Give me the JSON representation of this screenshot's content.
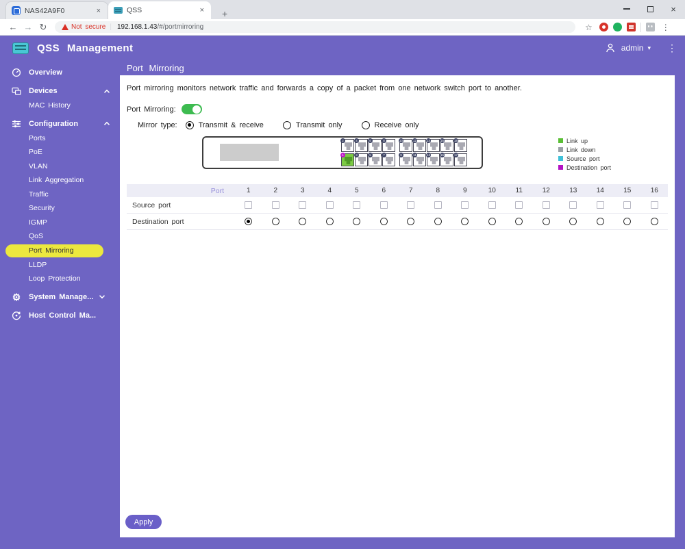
{
  "icons": {
    "back": "←",
    "forward": "→",
    "reload": "↻",
    "star": "☆",
    "menu_dots": "⋮",
    "close_x": "×",
    "new_tab": "+",
    "caret_down": "▾",
    "gear": "⚙"
  },
  "browser": {
    "tabs": [
      {
        "title": "NAS42A9F0",
        "active": false
      },
      {
        "title": "QSS",
        "active": true
      }
    ],
    "security_warning": "Not secure",
    "url_host": "192.168.1.43",
    "url_path": "/#/portmirroring",
    "url_separator": "|"
  },
  "header": {
    "app_title": "QSS Management",
    "user": "admin"
  },
  "sidebar": {
    "items": [
      {
        "label": "Overview",
        "icon": "gauge",
        "type": "top"
      },
      {
        "label": "Devices",
        "icon": "devices",
        "type": "top",
        "chevron": "up"
      },
      {
        "label": "MAC History",
        "type": "sub"
      },
      {
        "label": "Configuration",
        "icon": "sliders",
        "type": "top",
        "chevron": "up"
      },
      {
        "label": "Ports",
        "type": "sub"
      },
      {
        "label": "PoE",
        "type": "sub"
      },
      {
        "label": "VLAN",
        "type": "sub"
      },
      {
        "label": "Link Aggregation",
        "type": "sub"
      },
      {
        "label": "Traffic",
        "type": "sub"
      },
      {
        "label": "Security",
        "type": "sub"
      },
      {
        "label": "IGMP",
        "type": "sub"
      },
      {
        "label": "QoS",
        "type": "sub"
      },
      {
        "label": "Port Mirroring",
        "type": "sub",
        "active": true
      },
      {
        "label": "LLDP",
        "type": "sub"
      },
      {
        "label": "Loop Protection",
        "type": "sub"
      },
      {
        "label": "System Manage...",
        "icon": "gear",
        "type": "top",
        "chevron": "down",
        "chevron_inline": true
      },
      {
        "label": "Host Control Ma...",
        "icon": "host",
        "type": "top"
      }
    ]
  },
  "page": {
    "title": "Port Mirroring",
    "description": "Port mirroring monitors network traffic and forwards a copy of a packet from one network switch port to another.",
    "toggle_label": "Port Mirroring:",
    "toggle_on": true,
    "mirror_type_label": "Mirror type:",
    "mirror_options": [
      {
        "label": "Transmit & receive",
        "selected": true
      },
      {
        "label": "Transmit only",
        "selected": false
      },
      {
        "label": "Receive only",
        "selected": false
      }
    ],
    "switch_visual": {
      "groups": [
        {
          "top": [
            2,
            4,
            6,
            8
          ],
          "bottom": [
            1,
            3,
            5,
            7
          ]
        },
        {
          "top": [
            10,
            12,
            14,
            16,
            18
          ],
          "bottom": [
            9,
            11,
            13,
            15,
            17
          ]
        }
      ],
      "link_up_ports": [
        1
      ],
      "destination_ports": [
        1
      ],
      "source_ports": []
    },
    "legend": [
      {
        "label": "Link up",
        "color": "#5abf35"
      },
      {
        "label": "Link down",
        "color": "#9aa0a6"
      },
      {
        "label": "Source port",
        "color": "#3fc0d8"
      },
      {
        "label": "Destination port",
        "color": "#b312c4"
      }
    ],
    "table": {
      "port_header": "Port",
      "ports": [
        "1",
        "2",
        "3",
        "4",
        "5",
        "6",
        "7",
        "8",
        "9",
        "10",
        "11",
        "12",
        "13",
        "14",
        "15",
        "16"
      ],
      "rows": [
        {
          "label": "Source port",
          "control": "checkbox",
          "checked": []
        },
        {
          "label": "Destination port",
          "control": "radio",
          "selected": "1"
        }
      ]
    },
    "apply_label": "Apply"
  }
}
